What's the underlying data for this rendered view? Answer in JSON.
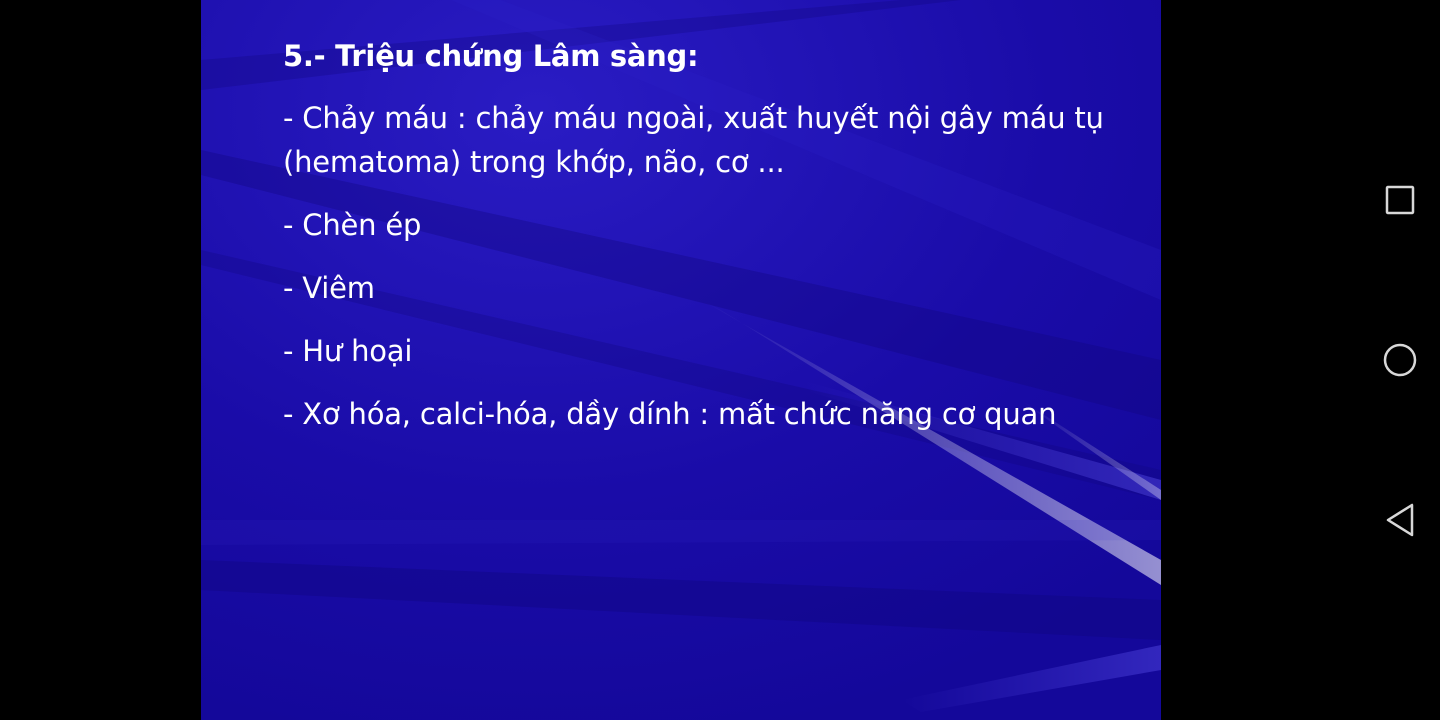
{
  "slide": {
    "title": "5.- Triệu chứng Lâm sàng:",
    "bullets": [
      "- Chảy máu : chảy máu ngoài, xuất huyết nội gây máu tụ (hematoma) trong khớp, não, cơ ...",
      "- Chèn ép",
      "- Viêm",
      "- Hư hoại",
      "- Xơ hóa, calci-hóa, dầy dính : mất chức năng cơ quan"
    ],
    "colors": {
      "background": "#1a0ca8",
      "text": "#ffffff"
    }
  },
  "navigation_bar": {
    "buttons": [
      {
        "name": "recents",
        "icon": "square-icon"
      },
      {
        "name": "home",
        "icon": "circle-icon"
      },
      {
        "name": "back",
        "icon": "triangle-back-icon"
      }
    ],
    "icon_color": "#d8d8d8"
  }
}
